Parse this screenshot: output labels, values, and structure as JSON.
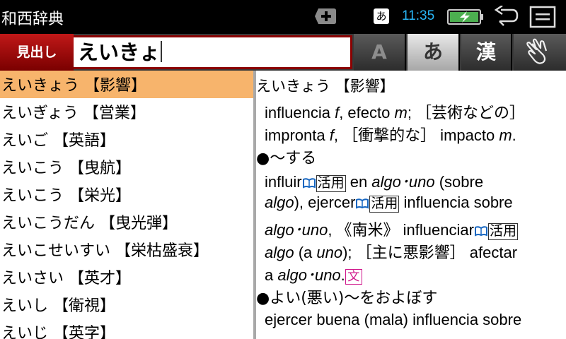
{
  "status_bar": {
    "app_title": "和西辞典",
    "ime_indicator": "あ",
    "time": "11:35",
    "icons": [
      "plus-icon",
      "ime-icon",
      "battery-charging-icon",
      "back-icon",
      "menu-icon"
    ]
  },
  "search": {
    "mode_label": "見出し",
    "query": "えいきょ",
    "mode_buttons": {
      "alpha": "A",
      "kana": "あ",
      "kanji": "漢",
      "handwriting": "handwriting-icon"
    },
    "active_mode": "kana"
  },
  "word_list": [
    "えいきょう 【影響】",
    "えいぎょう 【営業】",
    "えいご 【英語】",
    "えいこう 【曳航】",
    "えいこう 【栄光】",
    "えいこうだん 【曳光弾】",
    "えいこせいすい 【栄枯盛衰】",
    "えいさい 【英才】",
    "えいし 【衛視】",
    "えいじ 【英字】"
  ],
  "selected_index": 0,
  "detail": {
    "headword": "えいきょう 【影響】",
    "l1_a": "influencia ",
    "l1_a_g": "f",
    "l1_b": ", efecto ",
    "l1_b_g": "m",
    "l1_c": "; ［芸術などの］",
    "l2_a": "impronta ",
    "l2_a_g": "f",
    "l2_b": ", ［衝撃的な］ impacto ",
    "l2_b_g": "m",
    "l2_c": ".",
    "sub1": "●～する",
    "l3_a": "influir",
    "conj": "活用",
    "l3_b": " en ",
    "l3_b_i": "algo･uno",
    "l3_c": " (sobre",
    "l4_a_i": "algo",
    "l4_b": "), ejercer",
    "l4_c": " influencia sobre",
    "l5_a_i": "algo･uno",
    "l5_b": ", 《南米》 influenciar",
    "l6_a_i": "algo",
    "l6_b": " (a ",
    "l6_b_i": "uno",
    "l6_c": "); ［主に悪影響］ afectar",
    "l7_a": "a ",
    "l7_a_i": "algo･uno",
    "l7_b": ".",
    "bun": "文",
    "sub2": "●よい(悪い)～をおよぼす",
    "l8": "ejercer buena (mala) influencia sobre"
  },
  "colors": {
    "selected_row": "#f7b46c",
    "clock": "#29b6f6",
    "mode_label": "#c01818",
    "bun": "#d0188c",
    "link": "#1565c0"
  }
}
